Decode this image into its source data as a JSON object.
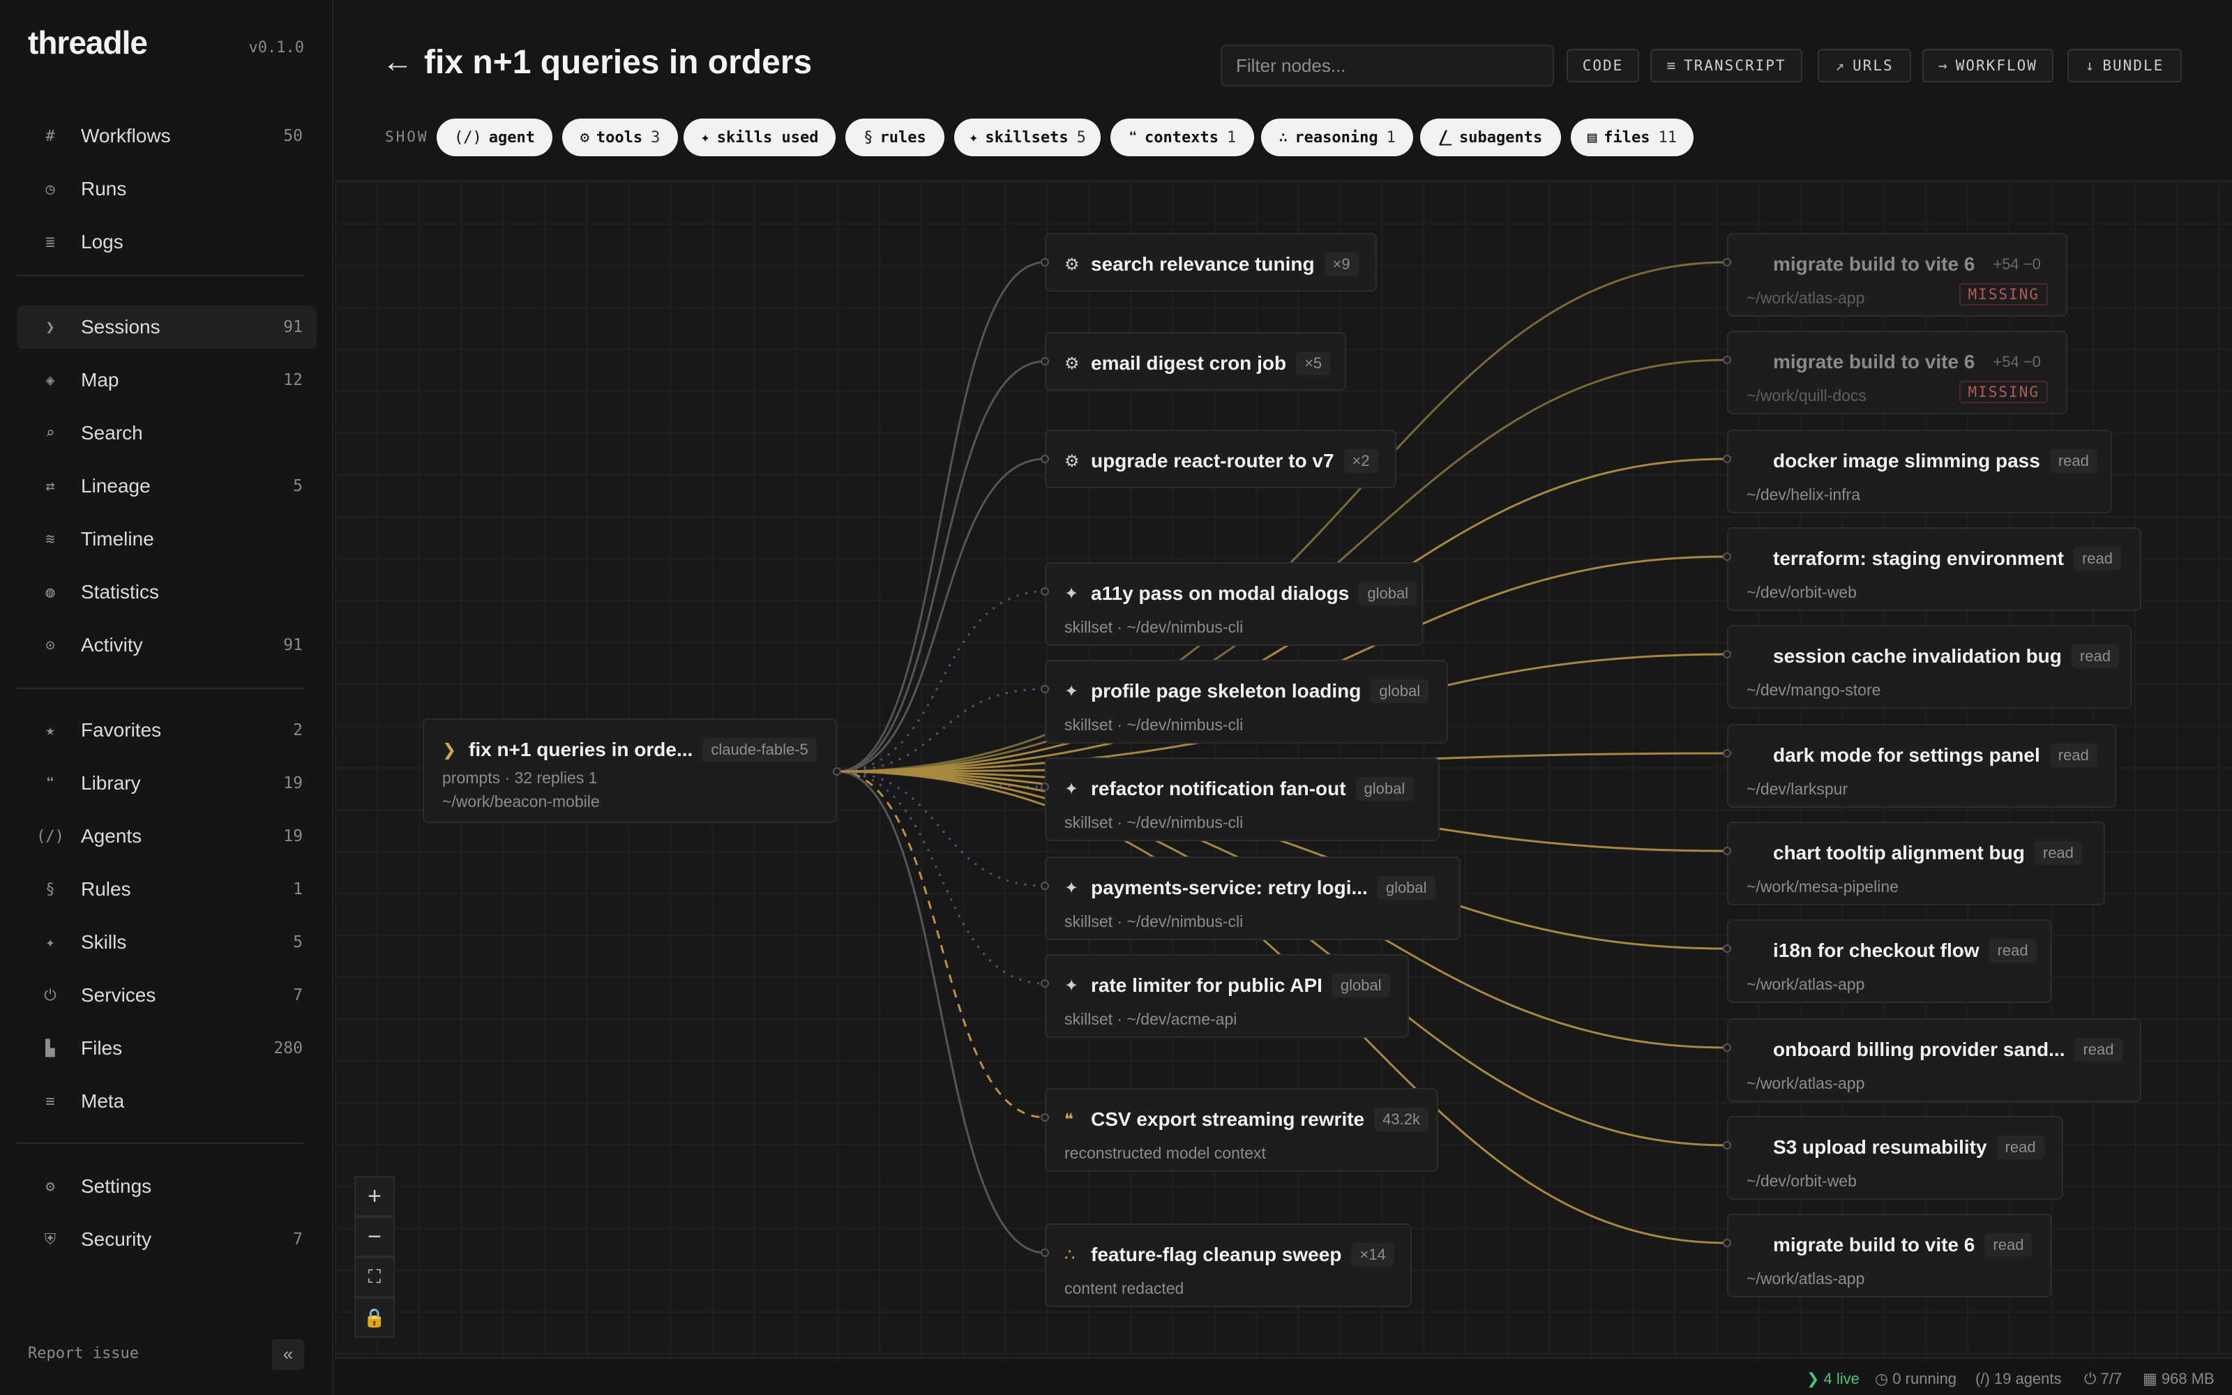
{
  "app": {
    "name": "threadle",
    "version": "v0.1.0"
  },
  "sidebar": {
    "group1": [
      {
        "icon": "#",
        "label": "Workflows",
        "count": "50"
      },
      {
        "icon": "◷",
        "label": "Runs",
        "count": ""
      },
      {
        "icon": "≣",
        "label": "Logs",
        "count": ""
      }
    ],
    "group2": [
      {
        "icon": "❯",
        "label": "Sessions",
        "count": "91",
        "active": true
      },
      {
        "icon": "◈",
        "label": "Map",
        "count": "12"
      },
      {
        "icon": "⌕",
        "label": "Search",
        "count": ""
      },
      {
        "icon": "⇄",
        "label": "Lineage",
        "count": "5"
      },
      {
        "icon": "≋",
        "label": "Timeline",
        "count": ""
      },
      {
        "icon": "◍",
        "label": "Statistics",
        "count": ""
      },
      {
        "icon": "⊙",
        "label": "Activity",
        "count": "91"
      }
    ],
    "group3": [
      {
        "icon": "★",
        "label": "Favorites",
        "count": "2"
      },
      {
        "icon": "❝",
        "label": "Library",
        "count": "19"
      },
      {
        "icon": "(/)",
        "label": "Agents",
        "count": "19"
      },
      {
        "icon": "§",
        "label": "Rules",
        "count": "1"
      },
      {
        "icon": "✦",
        "label": "Skills",
        "count": "5"
      },
      {
        "icon": "⏻",
        "label": "Services",
        "count": "7"
      },
      {
        "icon": "▙",
        "label": "Files",
        "count": "280"
      },
      {
        "icon": "≡",
        "label": "Meta",
        "count": ""
      }
    ],
    "group4": [
      {
        "icon": "⚙",
        "label": "Settings",
        "count": ""
      },
      {
        "icon": "⛨",
        "label": "Security",
        "count": "7"
      }
    ],
    "report_issue": "Report issue",
    "collapse_icon": "«"
  },
  "header": {
    "back": "←",
    "title": "fix n+1 queries in orders",
    "filter_placeholder": "Filter nodes...",
    "buttons": [
      {
        "icon": "",
        "label": "CODE"
      },
      {
        "icon": "≡",
        "label": "TRANSCRIPT"
      },
      {
        "icon": "↗",
        "label": "URLS"
      },
      {
        "icon": "→",
        "label": "WORKFLOW"
      },
      {
        "icon": "↓",
        "label": "BUNDLE"
      }
    ]
  },
  "show": {
    "label": "SHOW",
    "chips": [
      {
        "icon": "(/)",
        "label": "agent",
        "count": ""
      },
      {
        "icon": "⚙",
        "label": "tools",
        "count": "3"
      },
      {
        "icon": "✦",
        "label": "skills used",
        "count": ""
      },
      {
        "icon": "§",
        "label": "rules",
        "count": ""
      },
      {
        "icon": "✦",
        "label": "skillsets",
        "count": "5"
      },
      {
        "icon": "❝",
        "label": "contexts",
        "count": "1"
      },
      {
        "icon": "∴",
        "label": "reasoning",
        "count": "1"
      },
      {
        "icon": "⎳",
        "label": "subagents",
        "count": ""
      },
      {
        "icon": "▤",
        "label": "files",
        "count": "11"
      }
    ]
  },
  "graph": {
    "root": {
      "icon": "❯",
      "title": "fix n+1 queries in orde...",
      "badge": "claude-fable-5",
      "meta": "prompts · 32 replies 1",
      "path": "~/work/beacon-mobile"
    },
    "middle": [
      {
        "icon": "⚙",
        "title": "search relevance tuning",
        "badge": "×9",
        "meta": ""
      },
      {
        "icon": "⚙",
        "title": "email digest cron job",
        "badge": "×5",
        "meta": ""
      },
      {
        "icon": "⚙",
        "title": "upgrade react-router to v7",
        "badge": "×2",
        "meta": ""
      },
      {
        "icon": "✦",
        "title": "a11y pass on modal dialogs",
        "badge": "global",
        "meta": "skillset · ~/dev/nimbus-cli"
      },
      {
        "icon": "✦",
        "title": "profile page skeleton loading",
        "badge": "global",
        "meta": "skillset · ~/dev/nimbus-cli"
      },
      {
        "icon": "✦",
        "title": "refactor notification fan-out",
        "badge": "global",
        "meta": "skillset · ~/dev/nimbus-cli"
      },
      {
        "icon": "✦",
        "title": "payments-service: retry logi...",
        "badge": "global",
        "meta": "skillset · ~/dev/nimbus-cli"
      },
      {
        "icon": "✦",
        "title": "rate limiter for public API",
        "badge": "global",
        "meta": "skillset · ~/dev/acme-api"
      },
      {
        "icon": "❝",
        "title": "CSV export streaming rewrite",
        "badge": "43.2k",
        "meta": "reconstructed model context"
      },
      {
        "icon": "∴",
        "title": "feature-flag cleanup sweep",
        "badge": "×14",
        "meta": "content redacted"
      }
    ],
    "files": [
      {
        "title": "migrate build to vite 6",
        "badge": "+54 −0",
        "path": "~/work/atlas-app",
        "status": "MISSING"
      },
      {
        "title": "migrate build to vite 6",
        "badge": "+54 −0",
        "path": "~/work/quill-docs",
        "status": "MISSING"
      },
      {
        "title": "docker image slimming pass",
        "badge": "read",
        "path": "~/dev/helix-infra",
        "status": ""
      },
      {
        "title": "terraform: staging environment",
        "badge": "read",
        "path": "~/dev/orbit-web",
        "status": ""
      },
      {
        "title": "session cache invalidation bug",
        "badge": "read",
        "path": "~/dev/mango-store",
        "status": ""
      },
      {
        "title": "dark mode for settings panel",
        "badge": "read",
        "path": "~/dev/larkspur",
        "status": ""
      },
      {
        "title": "chart tooltip alignment bug",
        "badge": "read",
        "path": "~/work/mesa-pipeline",
        "status": ""
      },
      {
        "title": "i18n for checkout flow",
        "badge": "read",
        "path": "~/work/atlas-app",
        "status": ""
      },
      {
        "title": "onboard billing provider sand...",
        "badge": "read",
        "path": "~/work/atlas-app",
        "status": ""
      },
      {
        "title": "S3 upload resumability",
        "badge": "read",
        "path": "~/dev/orbit-web",
        "status": ""
      },
      {
        "title": "migrate build to vite 6",
        "badge": "read",
        "path": "~/work/atlas-app",
        "status": ""
      }
    ]
  },
  "zoom_controls": [
    "+",
    "−",
    "⛶",
    "🔒"
  ],
  "status_bar": {
    "live": "❯ 4 live",
    "running": "◷ 0 running",
    "agents": "(/) 19 agents",
    "services": "⏻ 7/7",
    "memory": "▦ 968 MB"
  },
  "colors": {
    "accent": "#d4a84a",
    "live": "#4cc47a",
    "background": "#161616"
  }
}
